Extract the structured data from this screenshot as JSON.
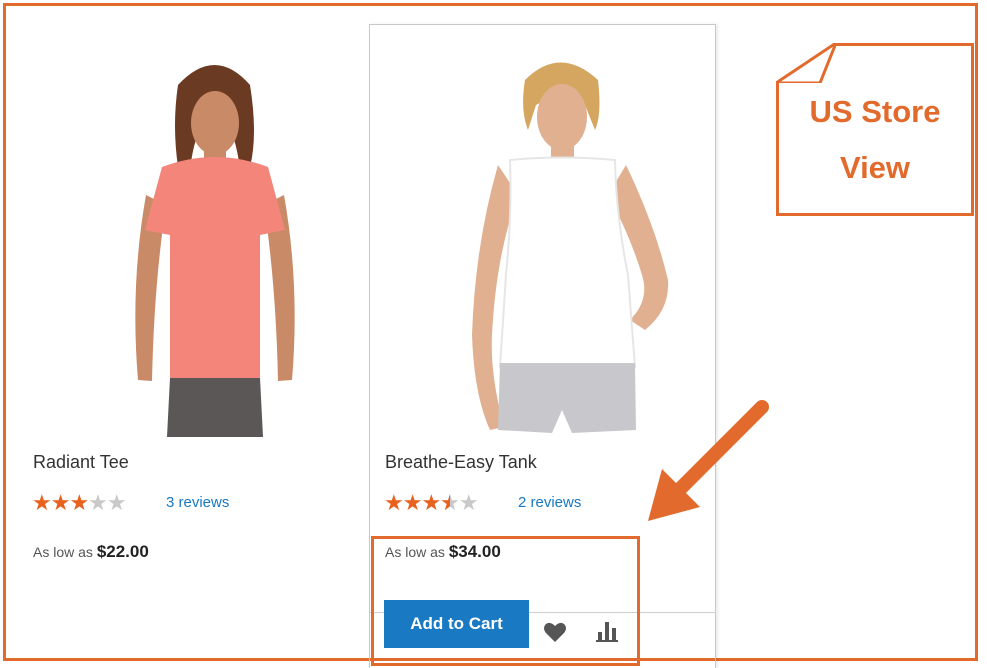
{
  "products": [
    {
      "name": "Radiant Tee",
      "rating": 3,
      "rating_max": 5,
      "reviews": "3 reviews",
      "price_prefix": "As low as",
      "price": "$22.00",
      "shirt_color": "#f3857a"
    },
    {
      "name": "Breathe-Easy Tank",
      "rating": 3.5,
      "rating_max": 5,
      "reviews": "2 reviews",
      "price_prefix": "As low as",
      "price": "$34.00",
      "shirt_color": "#ffffff",
      "actions": {
        "add_to_cart": "Add to Cart",
        "wishlist_icon": "heart-icon",
        "compare_icon": "bar-chart-icon"
      }
    }
  ],
  "callout": {
    "line1": "US Store",
    "line2": "View"
  },
  "colors": {
    "accent_orange": "#e26a2c",
    "button_blue": "#1979c3",
    "link_blue": "#1979c3",
    "star_on": "#e8611f",
    "star_off": "#c9c9c9"
  }
}
